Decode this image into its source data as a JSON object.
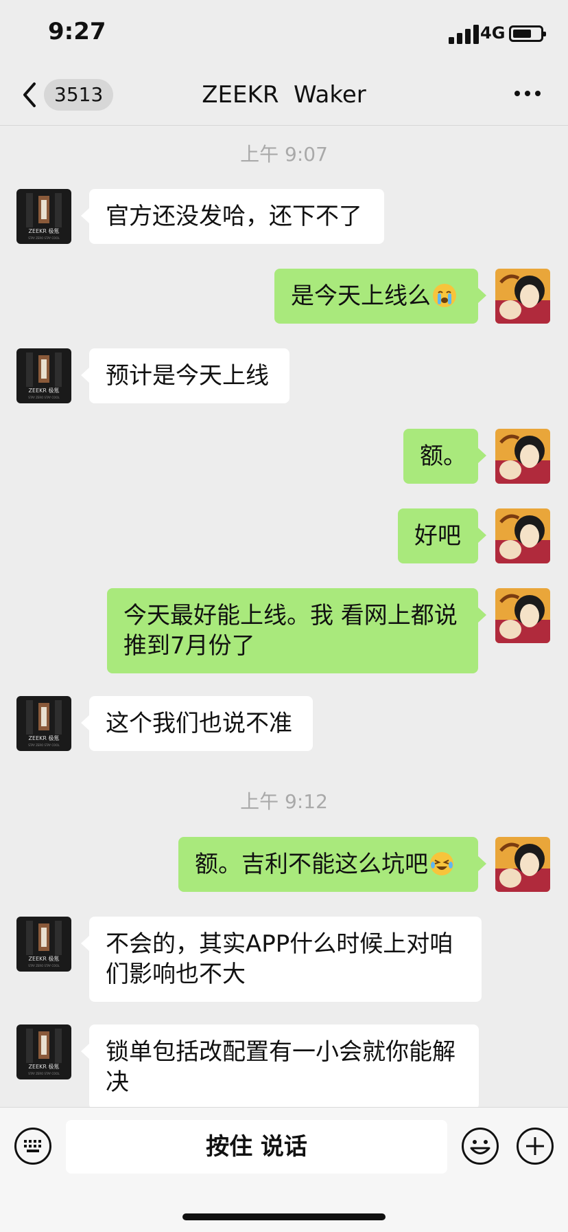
{
  "status": {
    "time": "9:27",
    "network": "4G"
  },
  "nav": {
    "unread_count": "3513",
    "title": "ZEEKR  Waker",
    "back_icon": "chevron-left-icon",
    "more_icon": "more-dots-icon"
  },
  "messages": [
    {
      "type": "time",
      "text": "上午 9:07"
    },
    {
      "type": "text",
      "from": "them",
      "text": "官方还没发哈，还下不了"
    },
    {
      "type": "text",
      "from": "me",
      "text": "是今天上线么",
      "emoji": "crying-emoji"
    },
    {
      "type": "text",
      "from": "them",
      "text": "预计是今天上线"
    },
    {
      "type": "text",
      "from": "me",
      "text": "额。"
    },
    {
      "type": "text",
      "from": "me",
      "text": "好吧"
    },
    {
      "type": "text",
      "from": "me",
      "text": "今天最好能上线。我 看网上都说推到7月份了"
    },
    {
      "type": "text",
      "from": "them",
      "text": "这个我们也说不准"
    },
    {
      "type": "time",
      "text": "上午 9:12"
    },
    {
      "type": "text",
      "from": "me",
      "text": "额。吉利不能这么坑吧",
      "emoji": "laughing-crying-emoji"
    },
    {
      "type": "text",
      "from": "them",
      "text": "不会的，其实APP什么时候上对咱们影响也不大"
    },
    {
      "type": "text",
      "from": "them",
      "text": "锁单包括改配置有一小会就你能解决"
    }
  ],
  "avatars": {
    "them": {
      "logo_text": "ZEEKR 极氪",
      "tagline": "STAY ZERO  STAY COOL"
    }
  },
  "input": {
    "voice_label": "按住 说话",
    "keyboard_icon": "keyboard-icon",
    "emoji_icon": "emoji-icon",
    "plus_icon": "plus-icon"
  },
  "colors": {
    "background": "#ededed",
    "outgoing_bubble": "#a9e97c",
    "incoming_bubble": "#ffffff",
    "timestamp": "#a9a9a9"
  }
}
